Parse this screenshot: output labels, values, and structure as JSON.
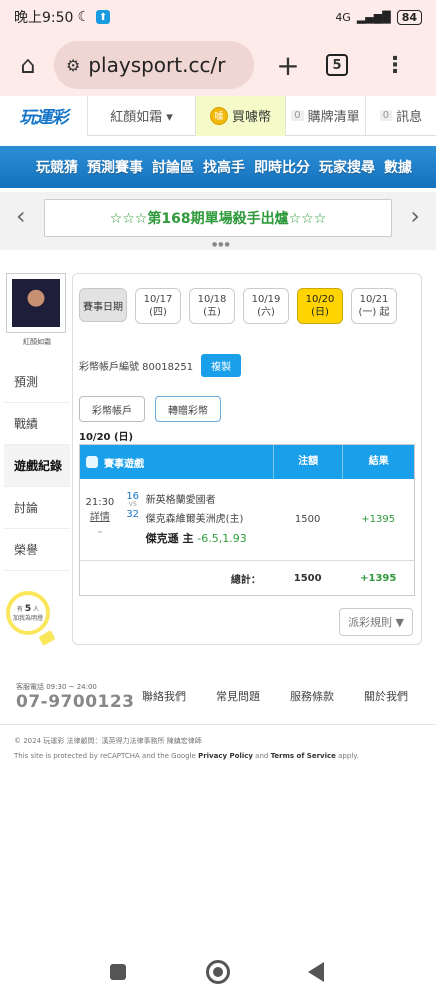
{
  "status_bar": {
    "time": "晚上9:50",
    "network": "4G",
    "battery": "84"
  },
  "browser": {
    "url": "playsport.cc/r",
    "tab_count": "5"
  },
  "site_header": {
    "logo": "玩運彩",
    "user_dropdown": "紅顏如霜 ▾",
    "buy_coins": "買噱幣",
    "coin_icon_text": "噱",
    "cart_count": "0",
    "cart": "購牌清單",
    "msg_count": "0",
    "messages": "訊息"
  },
  "nav": {
    "items": [
      "玩競猜",
      "預測賽事",
      "討論區",
      "找高手",
      "即時比分",
      "玩家搜尋",
      "數據"
    ]
  },
  "banner": {
    "text": "☆☆☆第168期單場殺手出爐☆☆☆",
    "prev": "‹",
    "next": "›"
  },
  "sidebar": {
    "username": "紅顏如霜",
    "items": [
      "預測",
      "戰績",
      "遊戲紀錄",
      "討論",
      "榮譽"
    ],
    "active": "遊戲紀錄",
    "bulb_prefix": "有",
    "bulb_count": "5",
    "bulb_suffix": "人",
    "bulb_text2": "加我為明燈"
  },
  "date_tabs": {
    "label": "賽事日期",
    "tabs": [
      {
        "date": "10/17",
        "day": "(四)"
      },
      {
        "date": "10/18",
        "day": "(五)"
      },
      {
        "date": "10/19",
        "day": "(六)"
      },
      {
        "date": "10/20",
        "day": "(日)"
      },
      {
        "date": "10/21",
        "day": "(一) 起"
      }
    ],
    "selected": "10/20"
  },
  "account": {
    "label": "彩幣帳戶編號 80018251",
    "copy_button": "複製"
  },
  "buttons": {
    "lottery_account": "彩幣帳戶",
    "transfer": "轉贈彩幣"
  },
  "record_date": "10/20 (日)",
  "table": {
    "headers": [
      "賽事遊戲",
      "注額",
      "結果"
    ],
    "rows": [
      {
        "time": "21:30",
        "detail": "詳情",
        "chev": "⌄",
        "away_no": "16",
        "vs": "VS",
        "home_no": "32",
        "away_team": "新英格蘭愛國者",
        "home_team": "傑克森維爾美洲虎(主)",
        "pick": "傑克遜 主",
        "odds": "-6.5,1.93",
        "amount": "1500",
        "result": "+1395"
      }
    ],
    "total_label": "總計：",
    "total_amount": "1500",
    "total_result": "+1395"
  },
  "rules_button": "派彩規則 ▼",
  "footer": {
    "service_hours": "客服電話 09:30 ~ 24:00",
    "phone": "07-9700123",
    "links": [
      "聯絡我們",
      "常見問題",
      "服務條款",
      "關於我們"
    ],
    "copyright": "© 2024 玩運彩 法律顧問：漢英得力法律事務所 陳鎮宏律師",
    "captcha_prefix": "This site is protected by reCAPTCHA and the Google ",
    "privacy": "Privacy Policy",
    "and": " and ",
    "terms": "Terms of Service",
    "apply": " apply."
  },
  "colors": {
    "accent_blue": "#1aa0ea",
    "selected_yellow": "#ffd400",
    "win_green": "#2e9a3c",
    "status_bg": "#fcebe8"
  },
  "icons": [
    "moon-icon",
    "app-notification-icon",
    "home-icon",
    "tune-icon",
    "plus-icon",
    "kebab-menu-icon",
    "coin-icon",
    "database-icon",
    "bulb-icon",
    "square-nav-icon",
    "circle-home-nav-icon",
    "back-nav-icon"
  ]
}
